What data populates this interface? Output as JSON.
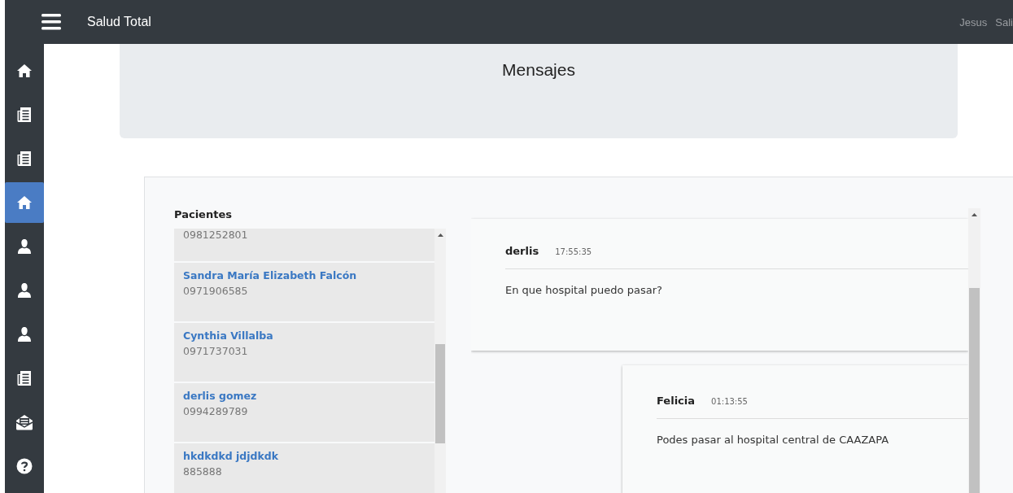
{
  "topbar": {
    "title": "Salud Total",
    "user": "Jesus",
    "logout": "Sali"
  },
  "sidebar": {
    "items": [
      {
        "kind": "home",
        "selected": false
      },
      {
        "kind": "document",
        "selected": false
      },
      {
        "kind": "document",
        "selected": false
      },
      {
        "kind": "home",
        "selected": true
      },
      {
        "kind": "user",
        "selected": false
      },
      {
        "kind": "user",
        "selected": false
      },
      {
        "kind": "user",
        "selected": false
      },
      {
        "kind": "document",
        "selected": false
      },
      {
        "kind": "mail",
        "selected": false
      },
      {
        "kind": "help",
        "selected": false
      }
    ]
  },
  "header": {
    "title": "Mensajes"
  },
  "patients": {
    "title": "Pacientes",
    "items": [
      {
        "phone": "0981252801"
      },
      {
        "name": "Sandra María Elizabeth Falcón",
        "phone": "0971906585"
      },
      {
        "name": "Cynthia Villalba",
        "phone": "0971737031"
      },
      {
        "name": "derlis gomez",
        "phone": "0994289789"
      },
      {
        "name": "hkdkdkd jdjdkdk",
        "phone": "885888"
      }
    ]
  },
  "messages": [
    {
      "author": "derlis",
      "time": "17:55:35",
      "text": "En que hospital puedo pasar?",
      "kind": "received"
    },
    {
      "author": "Felicia",
      "time": "01:13:55",
      "text": "Podes pasar al hospital central de CAAZAPA",
      "kind": "sent"
    }
  ]
}
